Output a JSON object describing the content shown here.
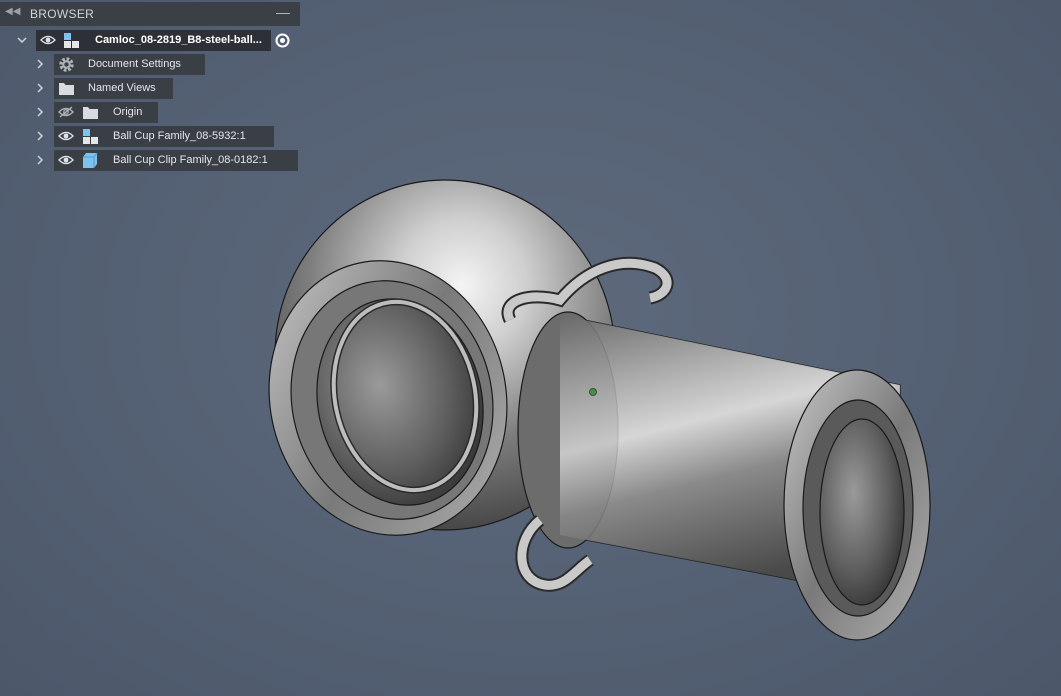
{
  "browser": {
    "title": "BROWSER",
    "root": {
      "label": "Camloc_08-2819_B8-steel-ball..."
    },
    "items": [
      {
        "label": "Document Settings"
      },
      {
        "label": "Named Views"
      },
      {
        "label": "Origin"
      },
      {
        "label": "Ball Cup Family_08-5932:1"
      },
      {
        "label": "Ball Cup Clip Family_08-0182:1"
      }
    ]
  },
  "icons": [
    "collapse-panel-icon",
    "minimize-icon",
    "chevron-down-icon",
    "chevron-right-icon",
    "eye-icon",
    "eye-hidden-icon",
    "gear-icon",
    "folder-icon",
    "component-icon",
    "body-icon",
    "radio-active-icon"
  ],
  "colors": {
    "panel": "#3a3f46",
    "viewport": "#566275",
    "body_icon": "#7ec3f0"
  }
}
